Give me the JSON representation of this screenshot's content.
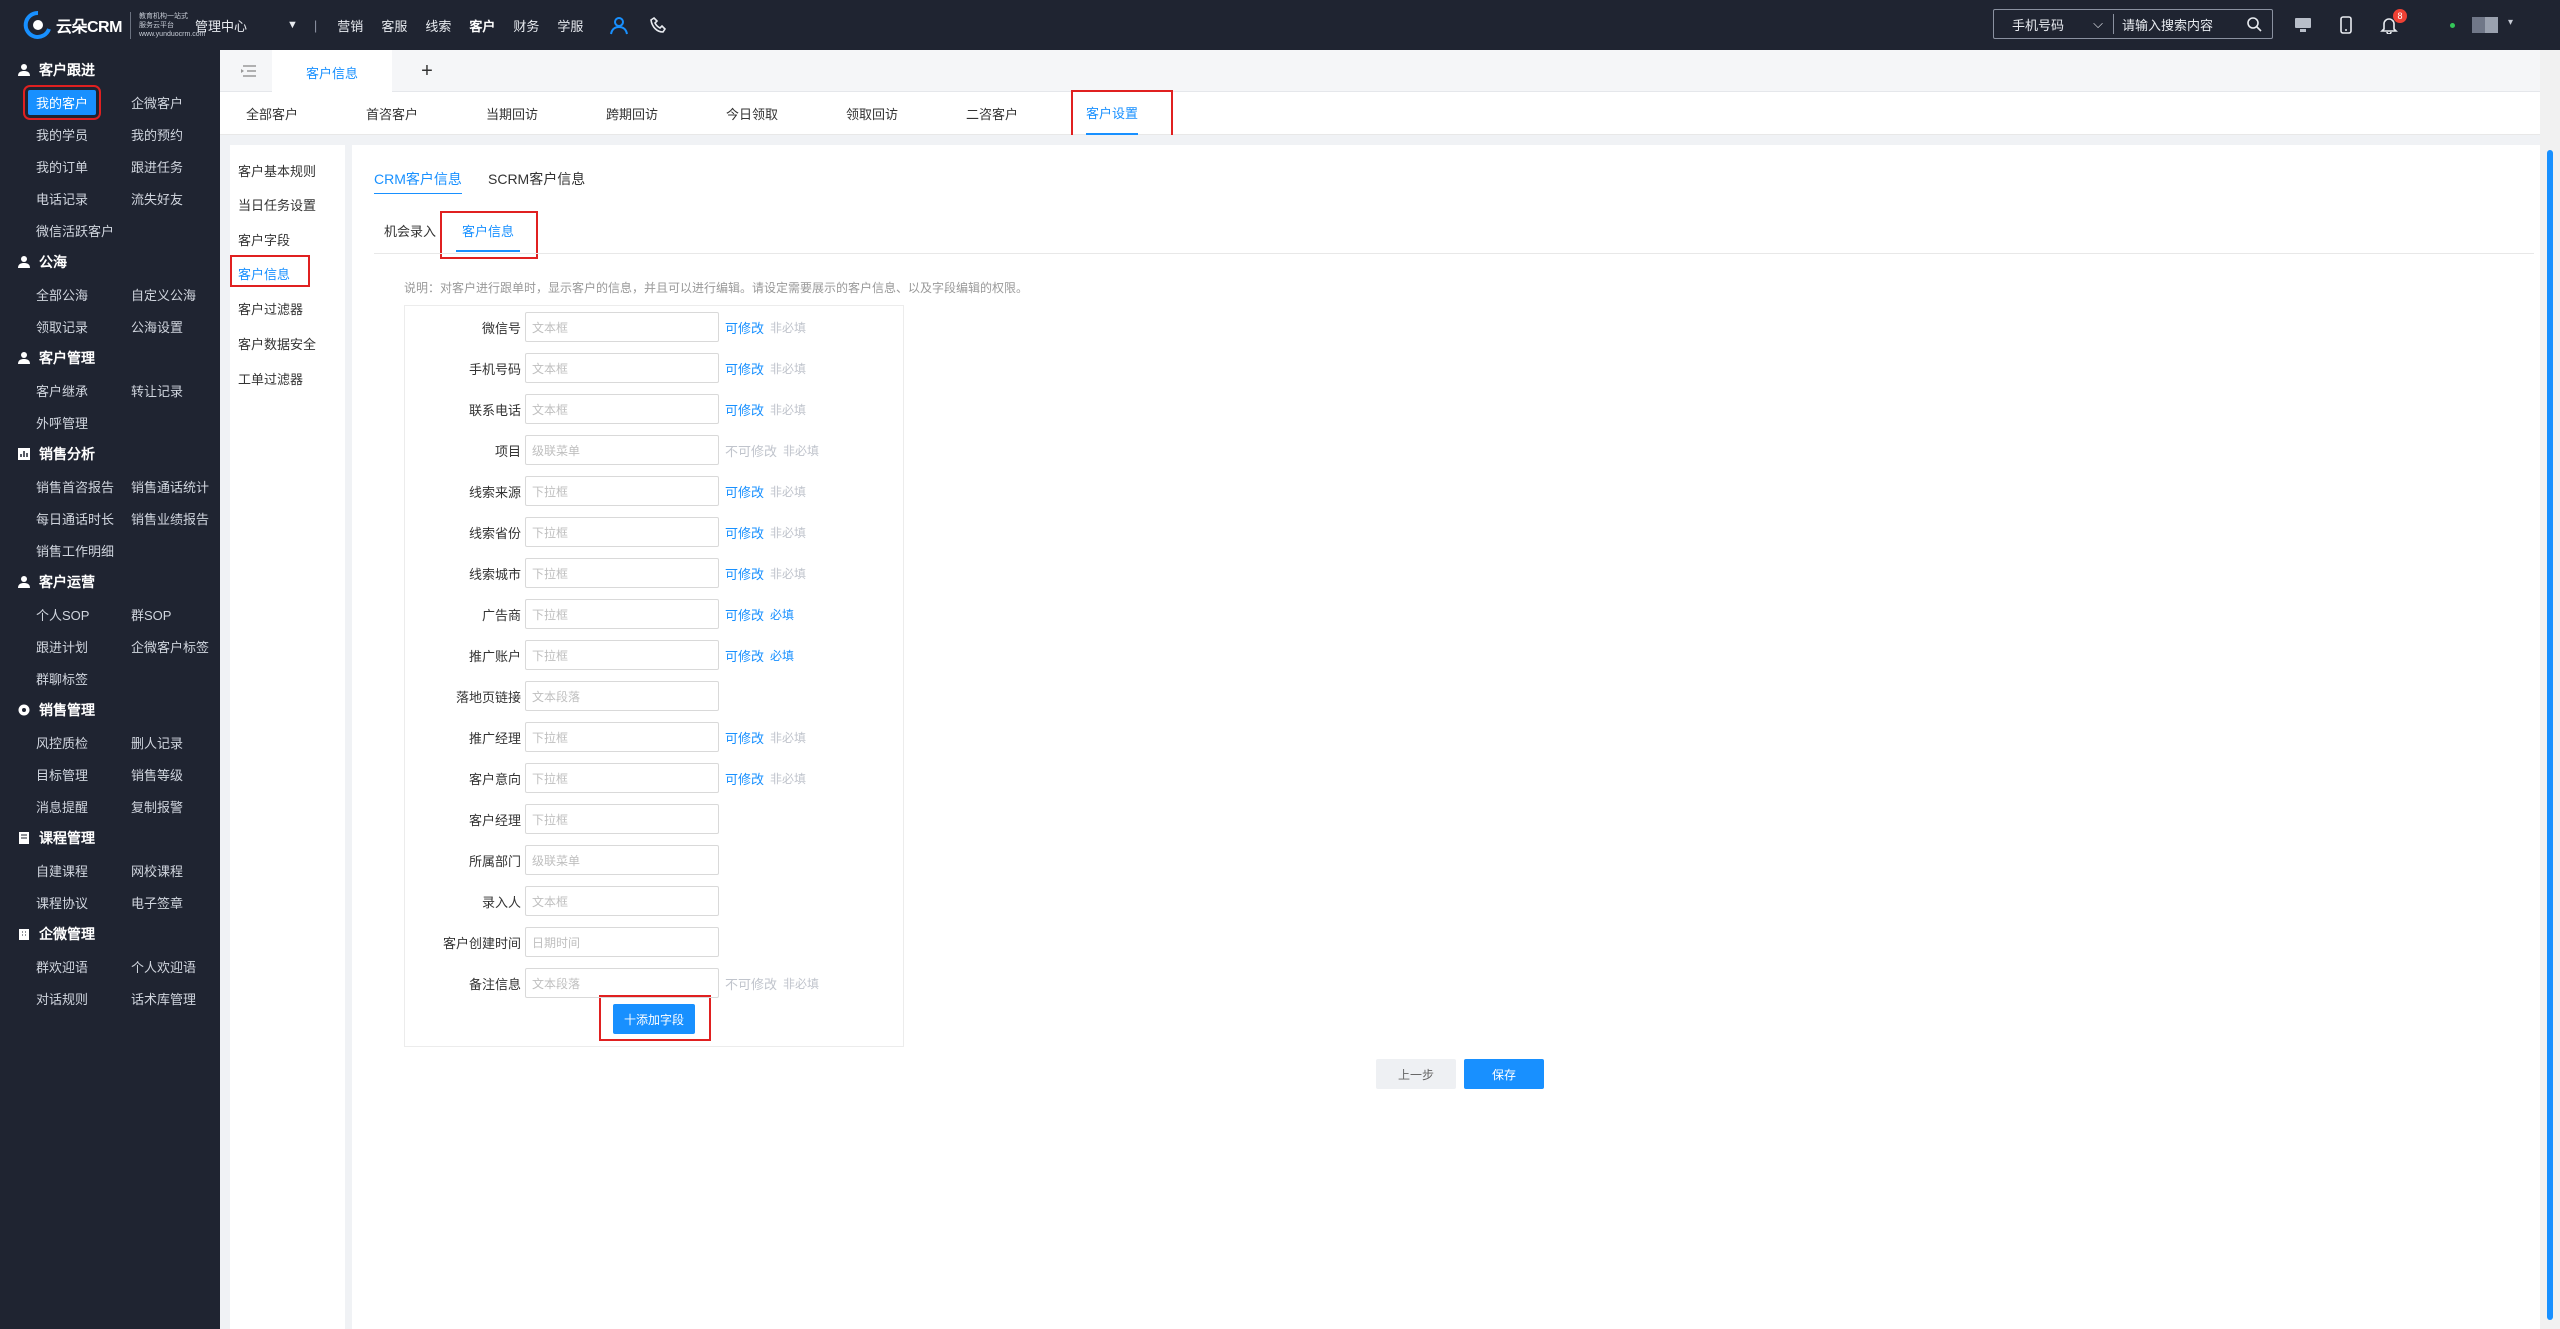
{
  "brand": {
    "name": "云朵CRM",
    "tagline": "教育机构一站式服务云平台",
    "url": "www.yunduocrm.com"
  },
  "topnav": {
    "management": "管理中心",
    "items": [
      {
        "label": "营销",
        "active": false
      },
      {
        "label": "客服",
        "active": false
      },
      {
        "label": "线索",
        "active": false
      },
      {
        "label": "客户",
        "active": true
      },
      {
        "label": "财务",
        "active": false
      },
      {
        "label": "学服",
        "active": false
      }
    ],
    "search": {
      "select": "手机号码",
      "placeholder": "请输入搜索内容"
    },
    "notification_count": "8"
  },
  "sidebar": {
    "groups": [
      {
        "title": "客户跟进",
        "icon": "user-icon",
        "items": [
          "我的客户",
          "企微客户",
          "我的学员",
          "我的预约",
          "我的订单",
          "跟进任务",
          "电话记录",
          "流失好友",
          "微信活跃客户"
        ]
      },
      {
        "title": "公海",
        "icon": "user-icon",
        "items": [
          "全部公海",
          "自定义公海",
          "领取记录",
          "公海设置"
        ]
      },
      {
        "title": "客户管理",
        "icon": "user-icon",
        "items": [
          "客户继承",
          "转让记录",
          "外呼管理"
        ]
      },
      {
        "title": "销售分析",
        "icon": "chart-icon",
        "items": [
          "销售首咨报告",
          "销售通话统计",
          "每日通话时长",
          "销售业绩报告",
          "销售工作明细"
        ]
      },
      {
        "title": "客户运营",
        "icon": "user-icon",
        "items": [
          "个人SOP",
          "群SOP",
          "跟进计划",
          "企微客户标签",
          "群聊标签"
        ]
      },
      {
        "title": "销售管理",
        "icon": "gear-icon",
        "items": [
          "风控质检",
          "删人记录",
          "目标管理",
          "销售等级",
          "消息提醒",
          "复制报警"
        ]
      },
      {
        "title": "课程管理",
        "icon": "book-icon",
        "items": [
          "自建课程",
          "网校课程",
          "课程协议",
          "电子签章"
        ]
      },
      {
        "title": "企微管理",
        "icon": "building-icon",
        "items": [
          "群欢迎语",
          "个人欢迎语",
          "对话规则",
          "话术库管理"
        ]
      }
    ]
  },
  "page_tab": "客户信息",
  "subtabs": [
    "全部客户",
    "首咨客户",
    "当期回访",
    "跨期回访",
    "今日领取",
    "领取回访",
    "二咨客户",
    "客户设置"
  ],
  "settings_nav": [
    "客户基本规则",
    "当日任务设置",
    "客户字段",
    "客户信息",
    "客户过滤器",
    "客户数据安全",
    "工单过滤器"
  ],
  "top_tabs": [
    "CRM客户信息",
    "SCRM客户信息"
  ],
  "inner_tabs": [
    "机会录入",
    "客户信息"
  ],
  "description": "说明：对客户进行跟单时，显示客户的信息，并且可以进行编辑。请设定需要展示的客户信息、以及字段编辑的权限。",
  "fields": [
    {
      "label": "微信号",
      "type": "文本框",
      "edit": "可修改",
      "editable": true,
      "req": "非必填",
      "required": false
    },
    {
      "label": "手机号码",
      "type": "文本框",
      "edit": "可修改",
      "editable": true,
      "req": "非必填",
      "required": false
    },
    {
      "label": "联系电话",
      "type": "文本框",
      "edit": "可修改",
      "editable": true,
      "req": "非必填",
      "required": false
    },
    {
      "label": "项目",
      "type": "级联菜单",
      "edit": "不可修改",
      "editable": false,
      "req": "非必填",
      "required": false
    },
    {
      "label": "线索来源",
      "type": "下拉框",
      "edit": "可修改",
      "editable": true,
      "req": "非必填",
      "required": false
    },
    {
      "label": "线索省份",
      "type": "下拉框",
      "edit": "可修改",
      "editable": true,
      "req": "非必填",
      "required": false
    },
    {
      "label": "线索城市",
      "type": "下拉框",
      "edit": "可修改",
      "editable": true,
      "req": "非必填",
      "required": false
    },
    {
      "label": "广告商",
      "type": "下拉框",
      "edit": "可修改",
      "editable": true,
      "req": "必填",
      "required": true
    },
    {
      "label": "推广账户",
      "type": "下拉框",
      "edit": "可修改",
      "editable": true,
      "req": "必填",
      "required": true
    },
    {
      "label": "落地页链接",
      "type": "文本段落",
      "edit": "",
      "editable": false,
      "req": "",
      "required": false
    },
    {
      "label": "推广经理",
      "type": "下拉框",
      "edit": "可修改",
      "editable": true,
      "req": "非必填",
      "required": false
    },
    {
      "label": "客户意向",
      "type": "下拉框",
      "edit": "可修改",
      "editable": true,
      "req": "非必填",
      "required": false
    },
    {
      "label": "客户经理",
      "type": "下拉框",
      "edit": "",
      "editable": false,
      "req": "",
      "required": false
    },
    {
      "label": "所属部门",
      "type": "级联菜单",
      "edit": "",
      "editable": false,
      "req": "",
      "required": false
    },
    {
      "label": "录入人",
      "type": "文本框",
      "edit": "",
      "editable": false,
      "req": "",
      "required": false
    },
    {
      "label": "客户创建时间",
      "type": "日期时间",
      "edit": "",
      "editable": false,
      "req": "",
      "required": false
    },
    {
      "label": "备注信息",
      "type": "文本段落",
      "edit": "不可修改",
      "editable": false,
      "req": "非必填",
      "required": false
    }
  ],
  "buttons": {
    "add_field": "十添加字段",
    "prev": "上一步",
    "save": "保存"
  },
  "colors": {
    "topbar": "#1f2431",
    "accent": "#1890ff",
    "highlight": "#e02020",
    "badge": "#f04134"
  }
}
